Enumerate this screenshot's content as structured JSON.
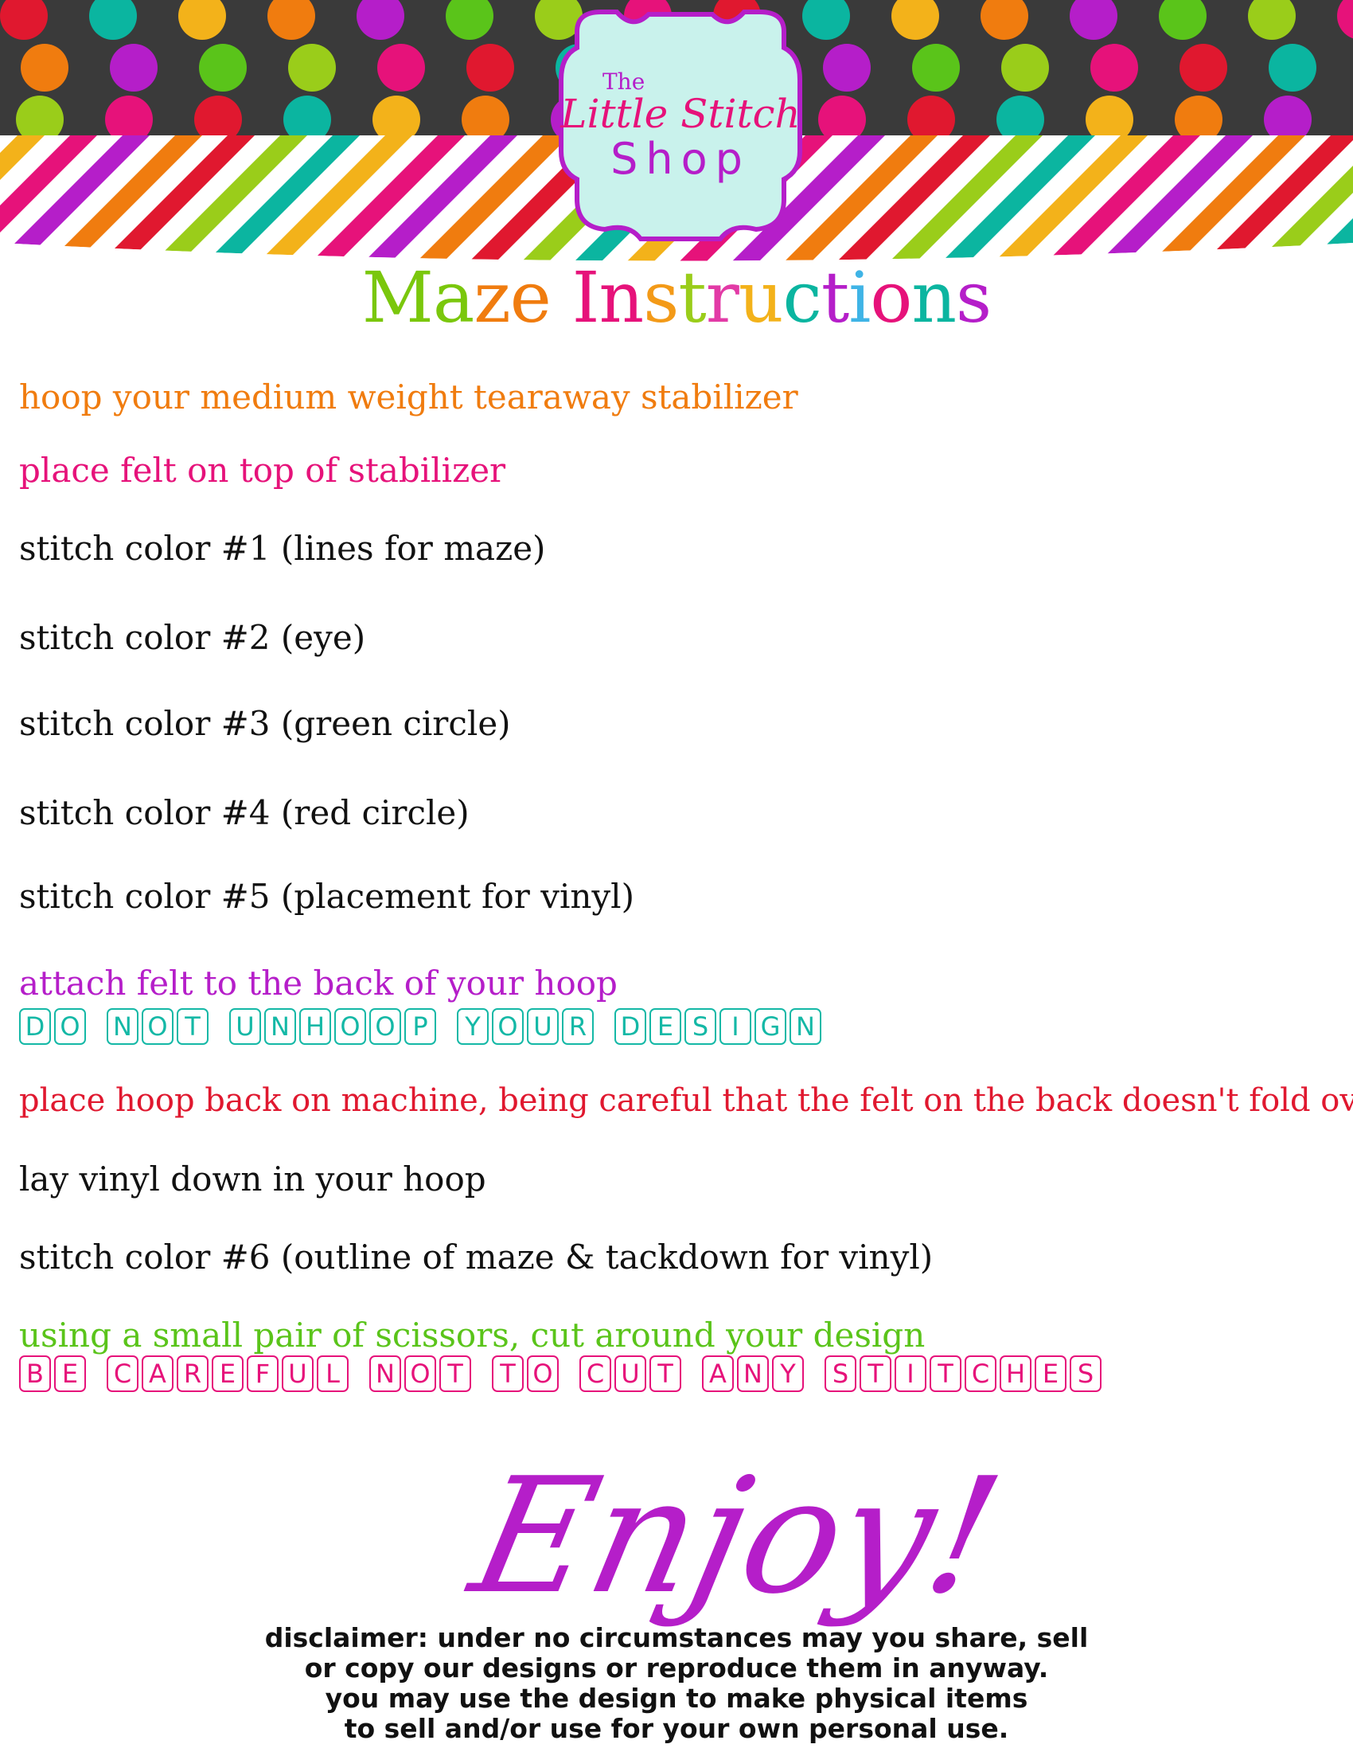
{
  "brand": {
    "line1": "The",
    "line2": "Little Stitch",
    "line3": "Shop"
  },
  "title": "Maze Instructions",
  "title_colors": [
    "#7ac70c",
    "#7ac70c",
    "#f07c0f",
    "#f07c0f",
    "#e6127a",
    "#e6127a",
    "#f39a18",
    "#9acd1a",
    "#e23aa6",
    "#f3b21a",
    "#0bb5a0",
    "#b51ec9",
    "#3fb4e6",
    "#e6127a",
    "#0bb5a0",
    "#b51ec9",
    "#0bb5a0"
  ],
  "steps": [
    {
      "text": "hoop your medium weight tearaway stabilizer",
      "color": "#f07c0f"
    },
    {
      "text": "place felt on top of stabilizer",
      "color": "#e6127a"
    },
    {
      "text": "stitch color #1 (lines for maze)",
      "color": "#111111"
    },
    {
      "text": "stitch color #2 (eye)",
      "color": "#111111"
    },
    {
      "text": "stitch color #3 (green circle)",
      "color": "#111111"
    },
    {
      "text": "stitch color #4 (red circle)",
      "color": "#111111"
    },
    {
      "text": "stitch color #5 (placement for vinyl)",
      "color": "#111111"
    },
    {
      "text": "attach felt to the back of your hoop",
      "color": "#b51ec9"
    },
    {
      "text": "place hoop back on machine, being careful that the felt on the back doesn't fold over",
      "color": "#e0182f"
    },
    {
      "text": "lay vinyl down in your hoop",
      "color": "#111111"
    },
    {
      "text": "stitch color #6 (outline of maze & tackdown for vinyl)",
      "color": "#111111"
    },
    {
      "text": "using a small pair of scissors, cut around your design",
      "color": "#5ac41a"
    }
  ],
  "notes": [
    {
      "text": "DO NOT UNHOOP YOUR DESIGN",
      "color": "#14b8a6"
    },
    {
      "text": "BE CAREFUL NOT TO CUT ANY STITCHES",
      "color": "#e6127a"
    }
  ],
  "enjoy": "Enjoy!",
  "disclaimer": [
    "disclaimer: under no circumstances may you share, sell",
    "or copy our designs or reproduce them in anyway.",
    "you may use the design to make physical items",
    "to sell and/or use for your own personal use."
  ],
  "palette": {
    "header_bg": "#3a3a3a",
    "dots": [
      "#e0182f",
      "#f07c0f",
      "#9acd1a",
      "#0bb5a0",
      "#b51ec9",
      "#e6127a",
      "#f3b21a",
      "#5ac41a"
    ],
    "logo_bg": "#c9f2ec",
    "logo_border": "#b51ec9"
  }
}
